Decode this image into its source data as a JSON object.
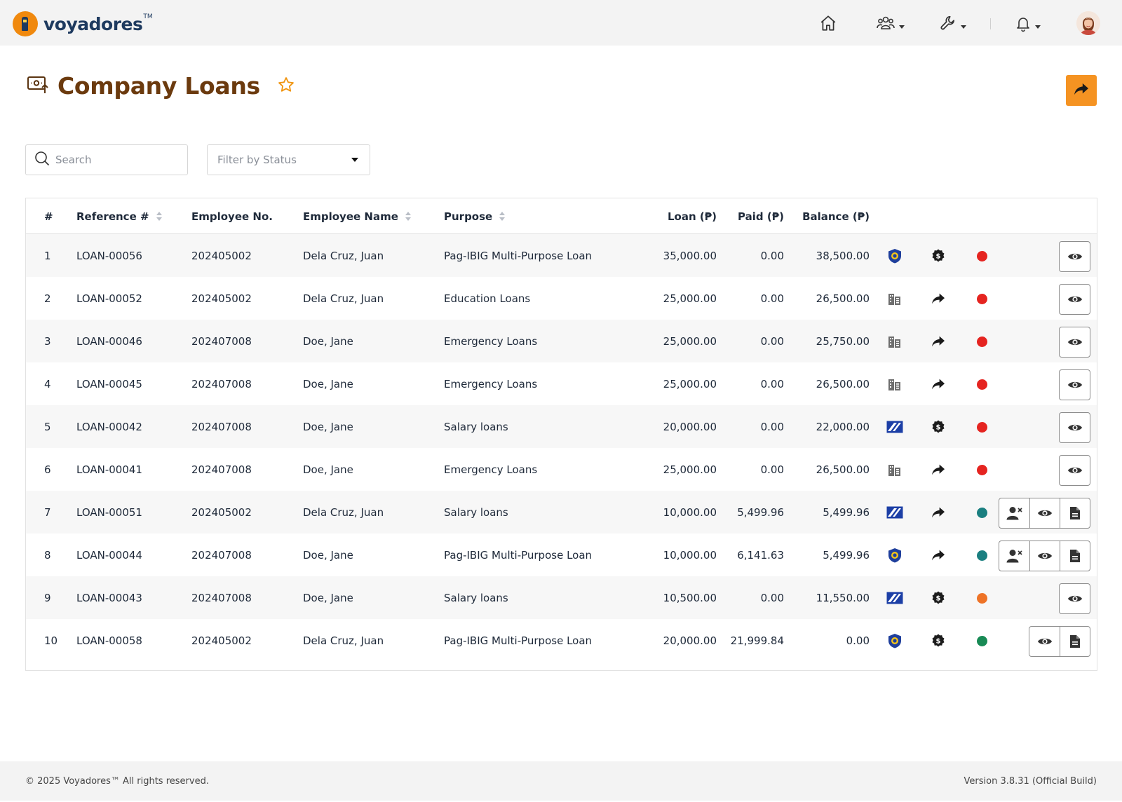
{
  "brand": {
    "name": "voyadores",
    "tm": "TM"
  },
  "nav": {
    "icons": [
      "home-icon",
      "users-icon",
      "wrench-icon",
      "bell-icon"
    ],
    "avatar": "user-avatar"
  },
  "page": {
    "title": "Company Loans",
    "title_icon": "loan-screen-icon",
    "favorite_icon": "star-outline-icon",
    "share_icon": "share-arrow-icon"
  },
  "filters": {
    "search_placeholder": "Search",
    "status_placeholder": "Filter by Status"
  },
  "table": {
    "columns": {
      "num": "#",
      "reference": "Reference #",
      "employee_no": "Employee No.",
      "employee_name": "Employee Name",
      "purpose": "Purpose",
      "loan": "Loan (₱)",
      "paid": "Paid (₱)",
      "balance": "Balance (₱)"
    },
    "status_colors": {
      "red": "#e52420",
      "teal": "#1a7f80",
      "orange": "#ee7327",
      "green": "#188a55"
    },
    "rows": [
      {
        "num": "1",
        "ref": "LOAN-00056",
        "emp": "202405002",
        "name": "Dela Cruz, Juan",
        "purpose": "Pag-IBIG Multi-Purpose Loan",
        "loan": "35,000.00",
        "paid": "0.00",
        "balance": "38,500.00",
        "source": "pagibig",
        "type": "dollar",
        "status": "red",
        "actions": [
          "view"
        ]
      },
      {
        "num": "2",
        "ref": "LOAN-00052",
        "emp": "202405002",
        "name": "Dela Cruz, Juan",
        "purpose": "Education Loans",
        "loan": "25,000.00",
        "paid": "0.00",
        "balance": "26,500.00",
        "source": "company",
        "type": "share",
        "status": "red",
        "actions": [
          "view"
        ]
      },
      {
        "num": "3",
        "ref": "LOAN-00046",
        "emp": "202407008",
        "name": "Doe, Jane",
        "purpose": "Emergency Loans",
        "loan": "25,000.00",
        "paid": "0.00",
        "balance": "25,750.00",
        "source": "company",
        "type": "share",
        "status": "red",
        "actions": [
          "view"
        ]
      },
      {
        "num": "4",
        "ref": "LOAN-00045",
        "emp": "202407008",
        "name": "Doe, Jane",
        "purpose": "Emergency Loans",
        "loan": "25,000.00",
        "paid": "0.00",
        "balance": "26,500.00",
        "source": "company",
        "type": "share",
        "status": "red",
        "actions": [
          "view"
        ]
      },
      {
        "num": "5",
        "ref": "LOAN-00042",
        "emp": "202407008",
        "name": "Doe, Jane",
        "purpose": "Salary loans",
        "loan": "20,000.00",
        "paid": "0.00",
        "balance": "22,000.00",
        "source": "sss",
        "type": "dollar",
        "status": "red",
        "actions": [
          "view"
        ]
      },
      {
        "num": "6",
        "ref": "LOAN-00041",
        "emp": "202407008",
        "name": "Doe, Jane",
        "purpose": "Emergency Loans",
        "loan": "25,000.00",
        "paid": "0.00",
        "balance": "26,500.00",
        "source": "company",
        "type": "share",
        "status": "red",
        "actions": [
          "view"
        ]
      },
      {
        "num": "7",
        "ref": "LOAN-00051",
        "emp": "202405002",
        "name": "Dela Cruz, Juan",
        "purpose": "Salary loans",
        "loan": "10,000.00",
        "paid": "5,499.96",
        "balance": "5,499.96",
        "source": "sss",
        "type": "share",
        "status": "teal",
        "actions": [
          "remove-user",
          "view",
          "document"
        ]
      },
      {
        "num": "8",
        "ref": "LOAN-00044",
        "emp": "202407008",
        "name": "Doe, Jane",
        "purpose": "Pag-IBIG Multi-Purpose Loan",
        "loan": "10,000.00",
        "paid": "6,141.63",
        "balance": "5,499.96",
        "source": "pagibig",
        "type": "share",
        "status": "teal",
        "actions": [
          "remove-user",
          "view",
          "document"
        ]
      },
      {
        "num": "9",
        "ref": "LOAN-00043",
        "emp": "202407008",
        "name": "Doe, Jane",
        "purpose": "Salary loans",
        "loan": "10,500.00",
        "paid": "0.00",
        "balance": "11,550.00",
        "source": "sss",
        "type": "dollar",
        "status": "orange",
        "actions": [
          "view"
        ]
      },
      {
        "num": "10",
        "ref": "LOAN-00058",
        "emp": "202405002",
        "name": "Dela Cruz, Juan",
        "purpose": "Pag-IBIG Multi-Purpose Loan",
        "loan": "20,000.00",
        "paid": "21,999.84",
        "balance": "0.00",
        "source": "pagibig",
        "type": "dollar",
        "status": "green",
        "actions": [
          "view",
          "document"
        ]
      }
    ]
  },
  "footer": {
    "copyright": "© 2025 Voyadores™ All rights reserved.",
    "version": "Version 3.8.31 (Official Build)"
  }
}
